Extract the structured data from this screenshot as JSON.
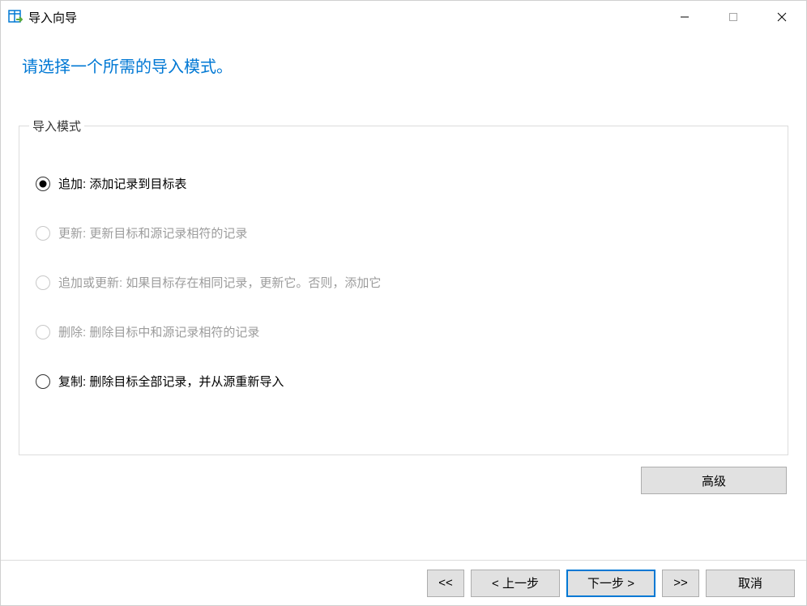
{
  "window": {
    "title": "导入向导"
  },
  "heading": "请选择一个所需的导入模式。",
  "fieldset": {
    "legend": "导入模式",
    "options": [
      {
        "label": "追加: 添加记录到目标表",
        "selected": true,
        "enabled": true
      },
      {
        "label": "更新: 更新目标和源记录相符的记录",
        "selected": false,
        "enabled": false
      },
      {
        "label": "追加或更新: 如果目标存在相同记录，更新它。否则，添加它",
        "selected": false,
        "enabled": false
      },
      {
        "label": "删除: 删除目标中和源记录相符的记录",
        "selected": false,
        "enabled": false
      },
      {
        "label": "复制: 删除目标全部记录，并从源重新导入",
        "selected": false,
        "enabled": true
      }
    ]
  },
  "buttons": {
    "advanced": "高级",
    "first": "<<",
    "prev": "< 上一步",
    "next": "下一步 >",
    "last": ">>",
    "cancel": "取消"
  }
}
